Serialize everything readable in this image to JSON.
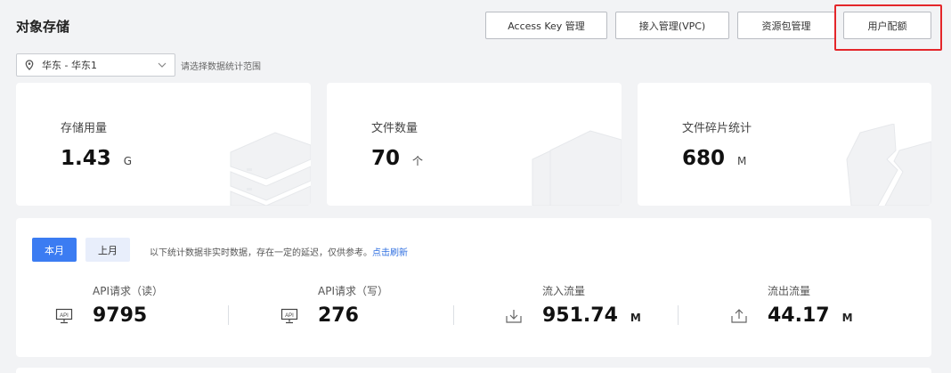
{
  "header": {
    "title": "对象存储",
    "buttons": {
      "access_key": "Access Key 管理",
      "vpc": "接入管理(VPC)",
      "package": "资源包管理",
      "quota": "用户配额"
    }
  },
  "region": {
    "selected": "华东 - 华东1",
    "hint": "请选择数据统计范围"
  },
  "cards": {
    "storage": {
      "label": "存储用量",
      "value": "1.43",
      "unit": "G"
    },
    "files": {
      "label": "文件数量",
      "value": "70",
      "unit": "个"
    },
    "fragments": {
      "label": "文件碎片统计",
      "value": "680",
      "unit": "M"
    }
  },
  "stats": {
    "tabs": {
      "current": "本月",
      "previous": "上月"
    },
    "notice": "以下统计数据非实时数据，存在一定的延迟，仅供参考。",
    "refresh": "点击刷新",
    "metrics": {
      "api_read": {
        "label": "API请求（读）",
        "value": "9795",
        "unit": ""
      },
      "api_write": {
        "label": "API请求（写）",
        "value": "276",
        "unit": ""
      },
      "inflow": {
        "label": "流入流量",
        "value": "951.74",
        "unit": "M"
      },
      "outflow": {
        "label": "流出流量",
        "value": "44.17",
        "unit": "M"
      }
    }
  },
  "colors": {
    "accent": "#3b7cf2",
    "highlight": "#e4262a",
    "link": "#2f6fe0"
  },
  "icons": {
    "region": "location-pin-icon",
    "dropdown": "chevron-down-icon",
    "api": "api-monitor-icon",
    "inflow": "download-icon",
    "outflow": "upload-icon"
  }
}
